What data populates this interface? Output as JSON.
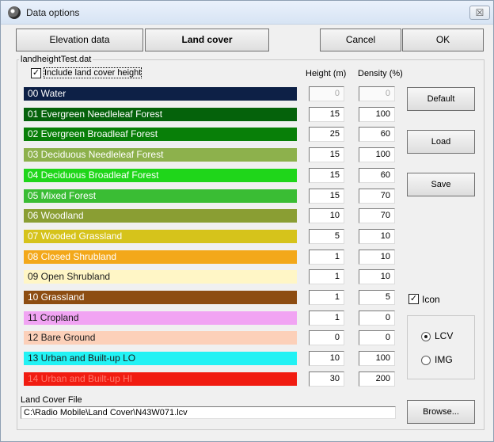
{
  "window": {
    "title": "Data options",
    "close_glyph": "☒"
  },
  "top_buttons": {
    "elevation": "Elevation data",
    "land_cover": "Land cover",
    "cancel": "Cancel",
    "ok": "OK"
  },
  "group": {
    "label": "landheightTest.dat"
  },
  "include_height": {
    "label": "Include land cover height",
    "checked": true
  },
  "headers": {
    "height": "Height (m)",
    "density": "Density (%)"
  },
  "rows": [
    {
      "label": "00  Water",
      "color": "#0d2046",
      "text_color": "#ffffff",
      "height": "0",
      "density": "0",
      "disabled": true
    },
    {
      "label": "01  Evergreen Needleleaf Forest",
      "color": "#05620b",
      "text_color": "#ffffff",
      "height": "15",
      "density": "100",
      "disabled": false
    },
    {
      "label": "02  Evergreen Broadleaf Forest",
      "color": "#087f08",
      "text_color": "#ffffff",
      "height": "25",
      "density": "60",
      "disabled": false
    },
    {
      "label": "03  Deciduous Needleleaf Forest",
      "color": "#8db14c",
      "text_color": "#ffffff",
      "height": "15",
      "density": "100",
      "disabled": false
    },
    {
      "label": "04  Deciduous Broadleaf Forest",
      "color": "#1fd61a",
      "text_color": "#ffffff",
      "height": "15",
      "density": "60",
      "disabled": false
    },
    {
      "label": "05  Mixed Forest",
      "color": "#3abd34",
      "text_color": "#ffffff",
      "height": "15",
      "density": "70",
      "disabled": false
    },
    {
      "label": "06  Woodland",
      "color": "#8a9e33",
      "text_color": "#ffffff",
      "height": "10",
      "density": "70",
      "disabled": false
    },
    {
      "label": "07  Wooded Grassland",
      "color": "#d6c31b",
      "text_color": "#ffffff",
      "height": "5",
      "density": "10",
      "disabled": false
    },
    {
      "label": "08  Closed Shrubland",
      "color": "#f3a81a",
      "text_color": "#ffffff",
      "height": "1",
      "density": "10",
      "disabled": false
    },
    {
      "label": "09  Open Shrubland",
      "color": "#fff6c6",
      "text_color": "#1a1a1a",
      "height": "1",
      "density": "10",
      "disabled": false
    },
    {
      "label": "10  Grassland",
      "color": "#8d4d12",
      "text_color": "#ffffff",
      "height": "1",
      "density": "5",
      "disabled": false
    },
    {
      "label": "11  Cropland",
      "color": "#f1a4f3",
      "text_color": "#1a1a1a",
      "height": "1",
      "density": "0",
      "disabled": false
    },
    {
      "label": "12  Bare Ground",
      "color": "#fcd0b9",
      "text_color": "#1a1a1a",
      "height": "0",
      "density": "0",
      "disabled": false
    },
    {
      "label": "13  Urban and Built-up LO",
      "color": "#22f2f4",
      "text_color": "#1a1a1a",
      "height": "10",
      "density": "100",
      "disabled": false
    },
    {
      "label": "14  Urban and Built-up HI",
      "color": "#f11c11",
      "text_color": "#ff7a6e",
      "height": "30",
      "density": "200",
      "disabled": false
    }
  ],
  "side_buttons": {
    "default": "Default",
    "load": "Load",
    "save": "Save",
    "browse": "Browse..."
  },
  "icon_option": {
    "label": "Icon",
    "checked": true
  },
  "format": {
    "lcv": "LCV",
    "img": "IMG",
    "selected": "LCV"
  },
  "land_cover_file": {
    "label": "Land Cover File",
    "value": "C:\\Radio Mobile\\Land Cover\\N43W071.lcv"
  }
}
